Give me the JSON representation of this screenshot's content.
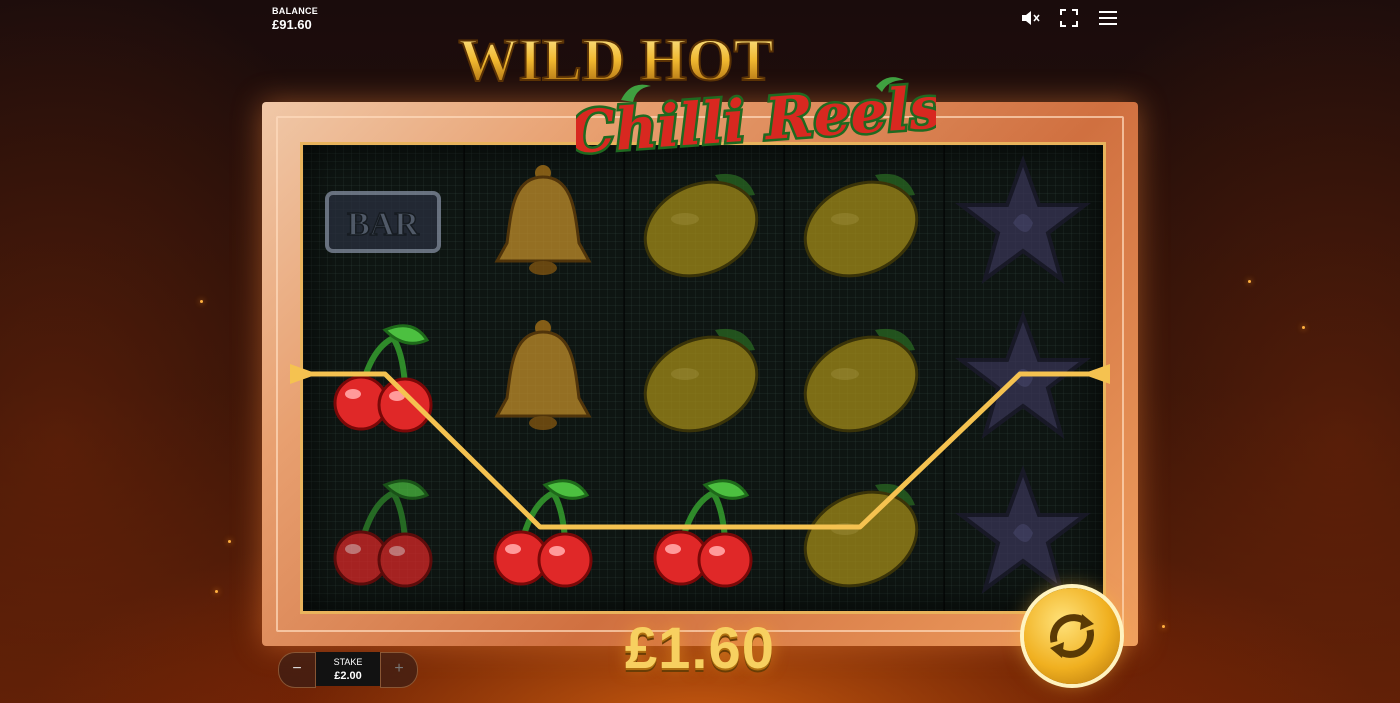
{
  "balance": {
    "label": "BALANCE",
    "value": "£91.60"
  },
  "logo": {
    "line1": "WILD HOT",
    "line2": "Chilli Reels"
  },
  "reels": [
    [
      "bar",
      "cherry",
      "cherry"
    ],
    [
      "bell",
      "bell",
      "cherry"
    ],
    [
      "lemon",
      "lemon",
      "cherry"
    ],
    [
      "lemon",
      "lemon",
      "lemon"
    ],
    [
      "star",
      "star",
      "star"
    ]
  ],
  "bar_text": "BAR",
  "win": {
    "amount": "£1.60"
  },
  "stake": {
    "label": "STAKE",
    "value": "£2.00",
    "minus": "−",
    "plus": "+"
  },
  "icons": {
    "sound": "mute-icon",
    "fullscreen": "fullscreen-icon",
    "menu": "menu-icon",
    "spin": "spin-icon"
  },
  "colors": {
    "gold": "#f7d060",
    "accent": "#f0b020",
    "reel_bg": "#0e1512"
  }
}
